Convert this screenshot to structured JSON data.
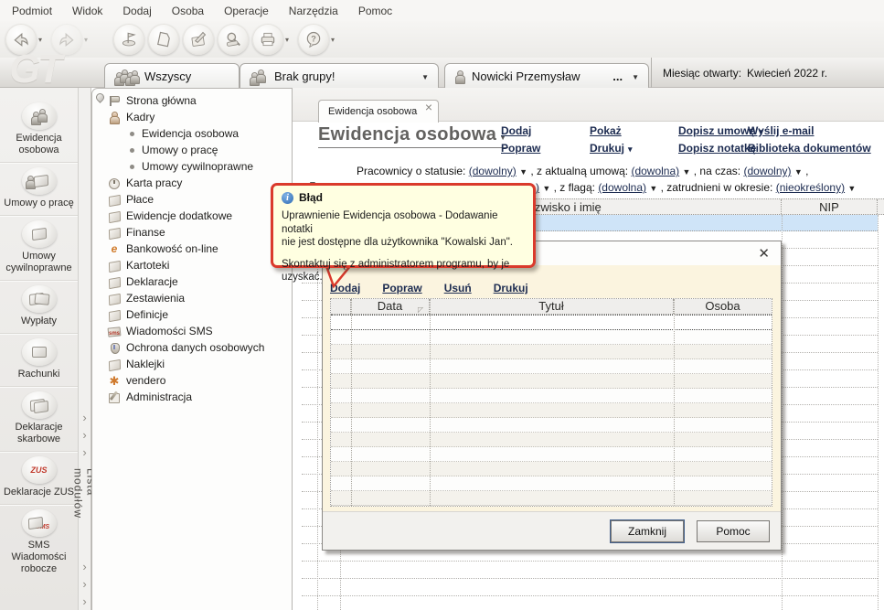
{
  "menu": {
    "items": [
      "Podmiot",
      "Widok",
      "Dodaj",
      "Osoba",
      "Operacje",
      "Narzędzia",
      "Pomoc"
    ]
  },
  "toolbar": {
    "buttons": [
      {
        "icon": "nav-back-icon",
        "dropdown": true,
        "disabled": false
      },
      {
        "icon": "nav-forward-icon",
        "dropdown": true,
        "disabled": true
      },
      {
        "icon": "flag-icon",
        "dropdown": false,
        "disabled": false
      },
      {
        "icon": "new-document-icon",
        "dropdown": false,
        "disabled": false
      },
      {
        "icon": "edit-icon",
        "dropdown": false,
        "disabled": false
      },
      {
        "icon": "search-icon",
        "dropdown": false,
        "disabled": false
      },
      {
        "icon": "print-icon",
        "dropdown": true,
        "disabled": false
      },
      {
        "icon": "help-icon",
        "dropdown": true,
        "disabled": false
      }
    ]
  },
  "header": {
    "logo": "GT",
    "tab_all_group": "Wszyscy",
    "tab_no_group": "Brak grupy!",
    "tab_person": "Nowicki Przemysław",
    "tab_person_ellipsis": "...",
    "month_label": "Miesiąc otwarty:",
    "month_value": "Kwiecień 2022 r."
  },
  "modules": {
    "panel_label": "Lista modułów",
    "items": [
      {
        "label": "Ewidencja osobowa",
        "icon": "people-icon"
      },
      {
        "label": "Umowy o pracę",
        "icon": "person-document-icon"
      },
      {
        "label": "Umowy cywilnoprawne",
        "icon": "document-icon"
      },
      {
        "label": "Wypłaty",
        "icon": "envelopes-icon"
      },
      {
        "label": "Rachunki",
        "icon": "envelope-icon"
      },
      {
        "label": "Deklaracje skarbowe",
        "icon": "documents-icon"
      },
      {
        "label": "Deklaracje ZUS",
        "icon": "zus-icon",
        "badge": "ZUS"
      },
      {
        "label": "SMS Wiadomości robocze",
        "icon": "sms-icon",
        "badge": "SMS"
      }
    ]
  },
  "tree": {
    "items": [
      {
        "label": "Strona główna"
      },
      {
        "label": "Kadry"
      },
      {
        "label": "Ewidencja osobowa",
        "sub": true
      },
      {
        "label": "Umowy o pracę",
        "sub": true
      },
      {
        "label": "Umowy cywilnoprawne",
        "sub": true
      },
      {
        "label": "Karta pracy"
      },
      {
        "label": "Płace"
      },
      {
        "label": "Ewidencje dodatkowe"
      },
      {
        "label": "Finanse"
      },
      {
        "label": "Bankowość on-line"
      },
      {
        "label": "Kartoteki"
      },
      {
        "label": "Deklaracje"
      },
      {
        "label": "Zestawienia"
      },
      {
        "label": "Definicje"
      },
      {
        "label": "Wiadomości SMS"
      },
      {
        "label": "Ochrona danych osobowych"
      },
      {
        "label": "Naklejki"
      },
      {
        "label": "vendero"
      },
      {
        "label": "Administracja"
      }
    ]
  },
  "doc_tab": {
    "label": "Ewidencja osobowa"
  },
  "page": {
    "title": "Ewidencja osobowa"
  },
  "actions": {
    "dodaj": "Dodaj",
    "popraw": "Popraw",
    "pokaz": "Pokaż",
    "drukuj": "Drukuj",
    "dopisz_umowe": "Dopisz umowę",
    "dopisz_notatke": "Dopisz notatkę",
    "wyslij_email": "Wyślij e-mail",
    "biblioteka": "Biblioteka dokumentów"
  },
  "filters": {
    "status_label": "Pracownicy o statusie:",
    "status_value": "(dowolny)",
    "umowa_label": ", z aktualną umową:",
    "umowa_value": "(dowolna)",
    "naczas_label": ", na czas:",
    "naczas_value": "(dowolny)",
    "row1_trailing": ",",
    "row2_fragment": ")",
    "flaga_label": ", z flagą:",
    "flaga_value": "(dowolna)",
    "okres_label": ", zatrudnieni w okresie:",
    "okres_value": "(nieokreślony)"
  },
  "employee_table": {
    "columns": [
      "Nazwisko i imię",
      "NIP"
    ]
  },
  "tooltip": {
    "title": "Błąd",
    "line1": "Uprawnienie Ewidencja osobowa - Dodawanie notatki",
    "line2": "nie jest dostępne dla użytkownika \"Kowalski Jan\".",
    "line3": "Skontaktuj się z administratorem programu, by je uzyskać."
  },
  "modal": {
    "links": {
      "dodaj": "Dodaj",
      "popraw": "Popraw",
      "usun": "Usuń",
      "drukuj": "Drukuj"
    },
    "columns": [
      "Data",
      "Tytuł",
      "Osoba"
    ],
    "buttons": {
      "zamknij": "Zamknij",
      "pomoc": "Pomoc"
    }
  },
  "colors": {
    "link": "#1c2b50",
    "selection_row": "#cfe4f8",
    "tooltip_bg": "#ffffe1",
    "tooltip_border": "#da3a2c",
    "dialog_bg": "#fbf4df"
  }
}
